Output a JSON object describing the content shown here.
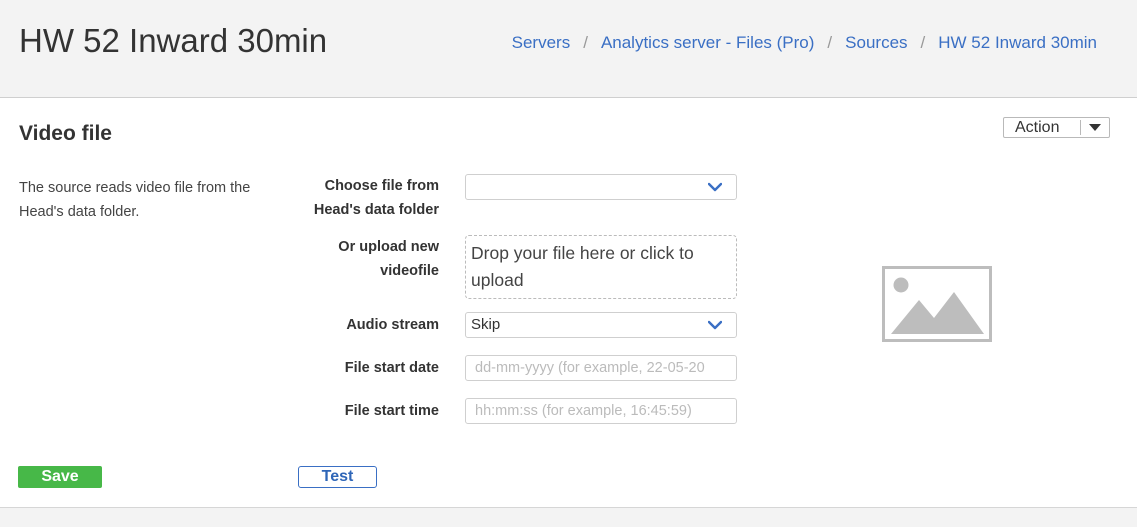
{
  "header": {
    "title": "HW 52 Inward 30min",
    "breadcrumb": [
      "Servers",
      "Analytics server - Files (Pro)",
      "Sources",
      "HW 52 Inward 30min"
    ]
  },
  "section": {
    "title": "Video file",
    "description": "The source reads video file from the Head's data folder.",
    "action_label": "Action"
  },
  "form": {
    "choose_file": {
      "label_line1": "Choose file from",
      "label_line2": "Head's data folder",
      "value": ""
    },
    "upload": {
      "label_line1": "Or upload new",
      "label_line2": "videofile",
      "text": "Drop your file here or click to upload"
    },
    "audio_stream": {
      "label": "Audio stream",
      "value": "Skip"
    },
    "start_date": {
      "label": "File start date",
      "placeholder": "dd-mm-yyyy (for example, 22-05-20"
    },
    "start_time": {
      "label": "File start time",
      "placeholder": "hh:mm:ss (for example, 16:45:59)"
    }
  },
  "buttons": {
    "save": "Save",
    "test": "Test"
  },
  "colors": {
    "link": "#3a6fc4",
    "save_green": "#47b848",
    "header_bg": "#f3f3f3"
  },
  "icons": {
    "dropdown": "chevron-down-icon",
    "preview": "image-placeholder-icon",
    "action_caret": "caret-down-icon"
  }
}
